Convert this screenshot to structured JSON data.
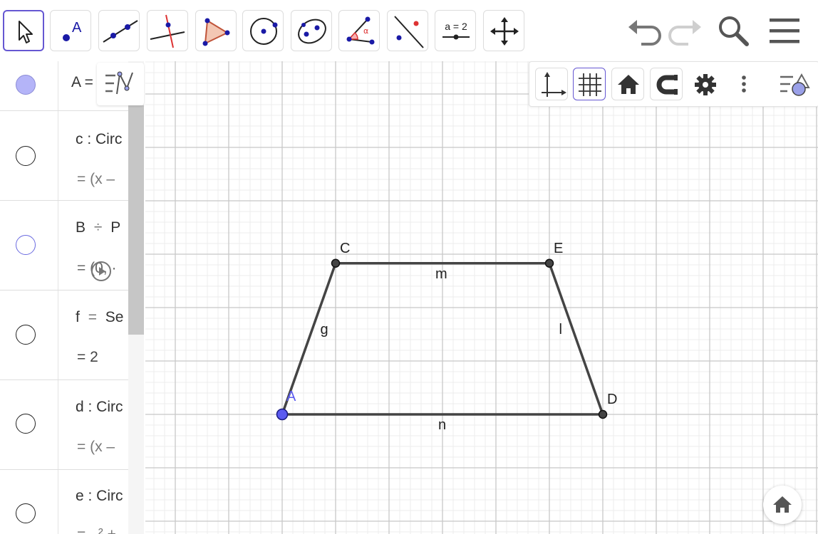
{
  "toolbar": {
    "tools": [
      {
        "name": "move-tool-button",
        "icon": "cursor-arrow-icon"
      },
      {
        "name": "point-tool-button",
        "icon": "point-icon"
      },
      {
        "name": "line-tool-button",
        "icon": "line-through-points-icon"
      },
      {
        "name": "perpendicular-tool-button",
        "icon": "perpendicular-line-icon"
      },
      {
        "name": "polygon-tool-button",
        "icon": "polygon-icon"
      },
      {
        "name": "circle-tool-button",
        "icon": "circle-center-point-icon"
      },
      {
        "name": "conic-tool-button",
        "icon": "ellipse-icon"
      },
      {
        "name": "angle-tool-button",
        "icon": "angle-icon"
      },
      {
        "name": "reflect-tool-button",
        "icon": "reflect-about-line-icon"
      },
      {
        "name": "slider-tool-button",
        "icon": "slider-icon"
      },
      {
        "name": "move-view-tool-button",
        "icon": "move-graphics-view-icon"
      }
    ],
    "slider_icon_text": "a = 2",
    "point_icon_letter": "A",
    "angle_icon_letter": "α"
  },
  "algebra": {
    "rows": [
      {
        "label": "A =",
        "marble": "filled"
      },
      {
        "label": "c : Circ",
        "definition": "= (x –",
        "marble": "hollow"
      },
      {
        "label": "B",
        "separator": "÷",
        "label_tail": "P",
        "definition": "= (0, ·",
        "marble": "hollow-blue"
      },
      {
        "label": "f",
        "separator": "=",
        "label_tail": "Se",
        "definition": "= 2",
        "marble": "hollow"
      },
      {
        "label": "d : Circ",
        "definition": "= (x –",
        "marble": "hollow"
      },
      {
        "label": "e : Circ",
        "definition": "= –² +",
        "marble": "hollow"
      }
    ]
  },
  "graphics": {
    "points": [
      {
        "name": "A",
        "x": 0,
        "y": 0,
        "color": "#5b5bf0"
      },
      {
        "name": "C",
        "x": 1,
        "y": 2.83
      },
      {
        "name": "E",
        "x": 5,
        "y": 2.83
      },
      {
        "name": "D",
        "x": 6,
        "y": 0
      }
    ],
    "segments": [
      {
        "name": "n",
        "from": "A",
        "to": "D"
      },
      {
        "name": "m",
        "from": "C",
        "to": "E"
      },
      {
        "name": "g",
        "from": "A",
        "to": "C"
      },
      {
        "name": "l",
        "from": "E",
        "to": "D"
      }
    ],
    "grid": true,
    "colors": {
      "accent": "#6557d2",
      "point_blue": "#5b5bf0",
      "point_dark": "#444444",
      "segment": "#444444"
    }
  }
}
